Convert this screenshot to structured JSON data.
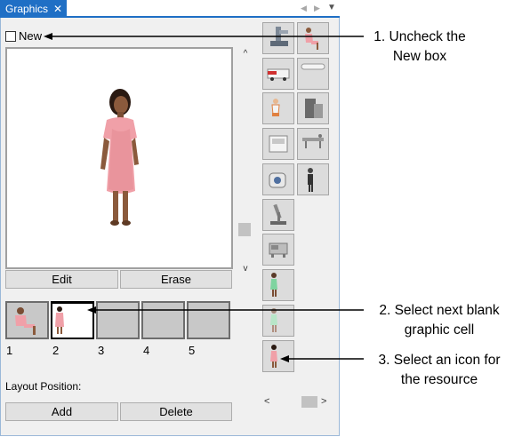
{
  "tab": {
    "title": "Graphics",
    "close_glyph": "✕"
  },
  "tab_controls": {
    "prev_glyph": "◀",
    "next_glyph": "▶",
    "menu_glyph": "▼"
  },
  "new_checkbox": {
    "label": "New",
    "checked": false
  },
  "preview": {
    "scroll_up_glyph": "^",
    "scroll_down_glyph": "v",
    "icon": "patient-figure-icon"
  },
  "buttons": {
    "edit": "Edit",
    "erase": "Erase",
    "add": "Add",
    "delete": "Delete"
  },
  "graphic_cells": [
    {
      "number": "1",
      "content": "seated-patient",
      "selected": false
    },
    {
      "number": "2",
      "content": "standing-patient",
      "selected": true
    },
    {
      "number": "3",
      "content": "blank",
      "selected": false
    },
    {
      "number": "4",
      "content": "blank",
      "selected": false
    },
    {
      "number": "5",
      "content": "blank",
      "selected": false
    }
  ],
  "layout_position_label": "Layout Position:",
  "icon_grid": [
    "microscope-stand-icon",
    "seated-patient-icon",
    "ambulance-icon",
    "blank-bar-icon",
    "nurse-icon",
    "server-rack-icon",
    "monitor-device-icon",
    "stretcher-icon",
    "scanner-icon",
    "standing-person-icon",
    "microscope-icon",
    "lab-machine-icon",
    "green-patient-icon",
    "green-patient-faded-icon",
    "pink-patient-icon"
  ],
  "hscroll": {
    "left_glyph": "<",
    "right_glyph": ">"
  },
  "annotations": {
    "step1": {
      "line1": "1. Uncheck the",
      "line2": "New box"
    },
    "step2": {
      "line1": "2. Select next blank",
      "line2": "graphic cell"
    },
    "step3": {
      "line1": "3. Select an icon for",
      "line2": "the resource"
    }
  },
  "colors": {
    "accent": "#1f6fc5",
    "patient_gown": "#f0a0a8",
    "skin": "#8b5a3c"
  }
}
